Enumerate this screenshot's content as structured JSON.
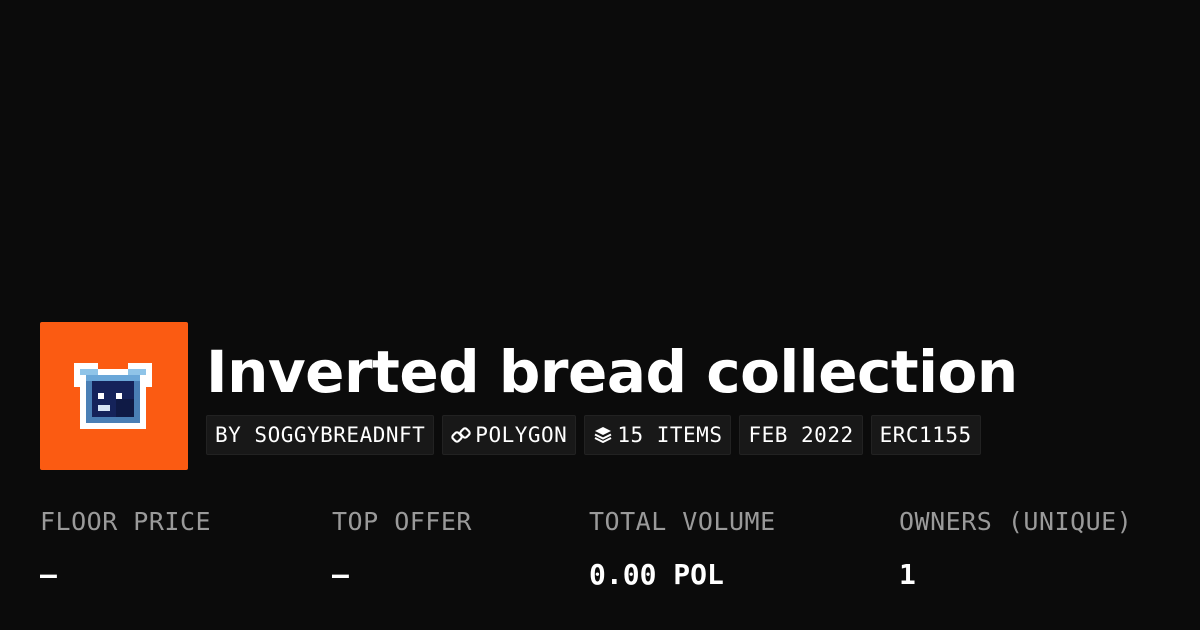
{
  "collection": {
    "title": "Inverted bread collection",
    "avatar_icon": "pixel-bread-icon",
    "avatar_bg": "#fb5b12"
  },
  "chips": {
    "creator": "BY SOGGYBREADNFT",
    "chain": "POLYGON",
    "chain_icon": "polygon-link-icon",
    "items": "15 ITEMS",
    "items_icon": "layers-icon",
    "date": "FEB 2022",
    "standard": "ERC1155"
  },
  "stats": [
    {
      "label": "FLOOR PRICE",
      "value": "–"
    },
    {
      "label": "TOP OFFER",
      "value": "–"
    },
    {
      "label": "TOTAL VOLUME",
      "value": "0.00 POL"
    },
    {
      "label": "OWNERS (UNIQUE)",
      "value": "1"
    }
  ]
}
